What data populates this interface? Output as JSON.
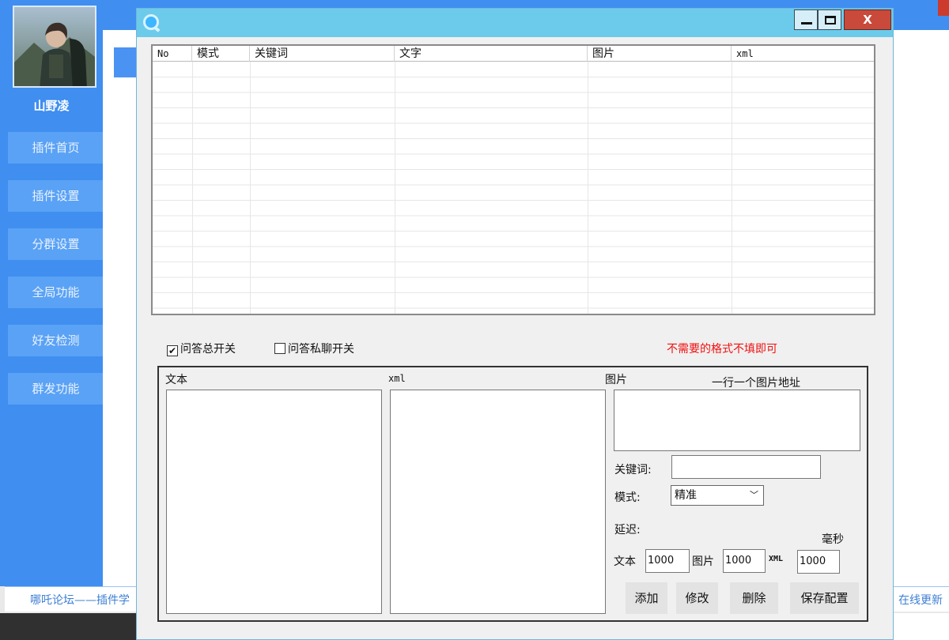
{
  "background_app": {
    "username": "山野凌",
    "nav_items": [
      "插件首页",
      "插件设置",
      "分群设置",
      "全局功能",
      "好友检测",
      "群发功能"
    ],
    "footer_link": "哪吒论坛——插件学",
    "footer_update": "在线更新"
  },
  "window": {
    "close_label": "X",
    "grid": {
      "columns": [
        "No",
        "模式",
        "关键词",
        "文字",
        "图片",
        "xml"
      ],
      "rows": []
    },
    "qa_master_switch": {
      "label": "问答总开关",
      "checked": true
    },
    "qa_private_switch": {
      "label": "问答私聊开关",
      "checked": false
    },
    "hint": "不需要的格式不填即可",
    "text_label": "文本",
    "xml_label": "xml",
    "image_label": "图片",
    "image_hint": "一行一个图片地址",
    "keyword_label": "关键词:",
    "mode_label": "模式:",
    "mode_value": "精准",
    "delay_label": "延迟:",
    "delay_unit": "毫秒",
    "delay_text_label": "文本",
    "delay_text_value": "1000",
    "delay_image_label": "图片",
    "delay_image_value": "1000",
    "delay_xml_label": "XML",
    "delay_xml_value": "1000",
    "buttons": {
      "add": "添加",
      "edit": "修改",
      "delete": "删除",
      "save": "保存配置"
    }
  },
  "colors": {
    "accent_blue": "#3f8ef0",
    "titlebar": "#6ccbea",
    "hint_red": "#f01010",
    "close_red": "#c9493b"
  }
}
